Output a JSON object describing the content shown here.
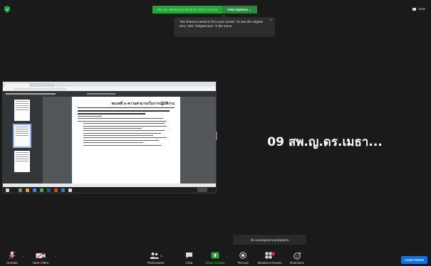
{
  "top_bar": {
    "share_banner": "You are viewing 09 สพ.ญ.ดร.เมธา's screen",
    "view_options": "View Options",
    "view_options_caret": "⌄",
    "view_label": "View"
  },
  "tooltip": {
    "text": "The shared content is fit to your screen. To see the original size, click \"Original size\" in the menu.",
    "close": "×"
  },
  "shared_screen": {
    "page_heading": "หมวดที่ ๓ ความสามารถในการปฏิบัติงาน"
  },
  "participant": {
    "name": "09 สพ.ญ.ดร.เมธา..."
  },
  "breakout": {
    "unassigned_text": "25 unassigned participants"
  },
  "toolbar": {
    "unmute": "Unmute",
    "start_video": "Start Video",
    "participants": "Participants",
    "participants_count": "1",
    "chat": "Chat",
    "share_screen": "Share Screen",
    "record": "Record",
    "breakout_rooms": "Breakout Rooms",
    "reactions": "Reactions",
    "leave_room": "Leave Room",
    "caret": "^"
  },
  "colors": {
    "accent_green": "#23a63a",
    "leave_blue": "#0e71eb",
    "alert_red": "#e02828"
  }
}
